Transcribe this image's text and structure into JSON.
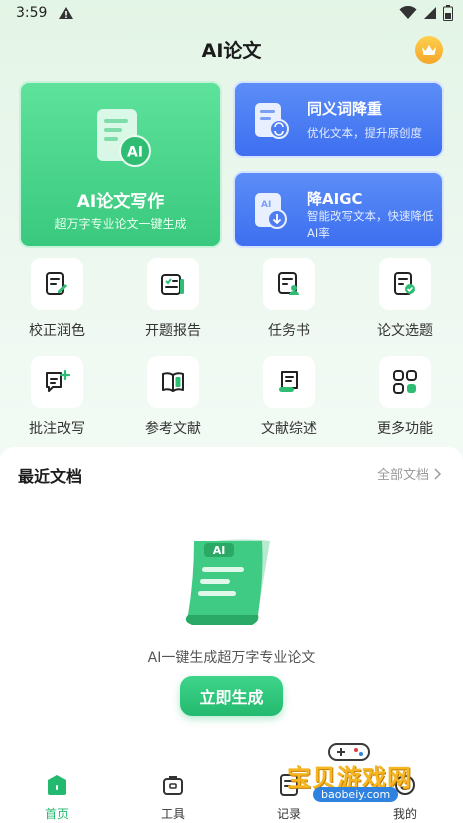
{
  "status": {
    "time": "3:59"
  },
  "header": {
    "title": "AI论文"
  },
  "cards": {
    "writing": {
      "title": "AI论文写作",
      "subtitle": "超万字专业论文一键生成"
    },
    "rewrite": {
      "title": "同义词降重",
      "subtitle": "优化文本，提升原创度"
    },
    "aigc": {
      "title": "降AIGC",
      "subtitle": "智能改写文本，快速降低AI率"
    }
  },
  "features": [
    {
      "label": "校正润色",
      "icon": "edit-doc-icon"
    },
    {
      "label": "开题报告",
      "icon": "checklist-icon"
    },
    {
      "label": "任务书",
      "icon": "person-doc-icon"
    },
    {
      "label": "论文选题",
      "icon": "check-doc-icon"
    },
    {
      "label": "批注改写",
      "icon": "comment-plus-icon"
    },
    {
      "label": "参考文献",
      "icon": "book-icon"
    },
    {
      "label": "文献综述",
      "icon": "scroll-icon"
    },
    {
      "label": "更多功能",
      "icon": "grid-icon"
    }
  ],
  "recent": {
    "title": "最近文档",
    "all_link": "全部文档",
    "empty_text": "AI一键生成超万字专业论文",
    "generate_button": "立即生成"
  },
  "nav": [
    {
      "label": "首页",
      "active": true
    },
    {
      "label": "工具"
    },
    {
      "label": "记录"
    },
    {
      "label": "我的"
    }
  ],
  "watermark": {
    "text": "宝贝游戏网",
    "url": "baobeiy.com"
  },
  "colors": {
    "green": "#23b96e",
    "blue": "#3d6ff0",
    "gold": "#f4a62a"
  }
}
